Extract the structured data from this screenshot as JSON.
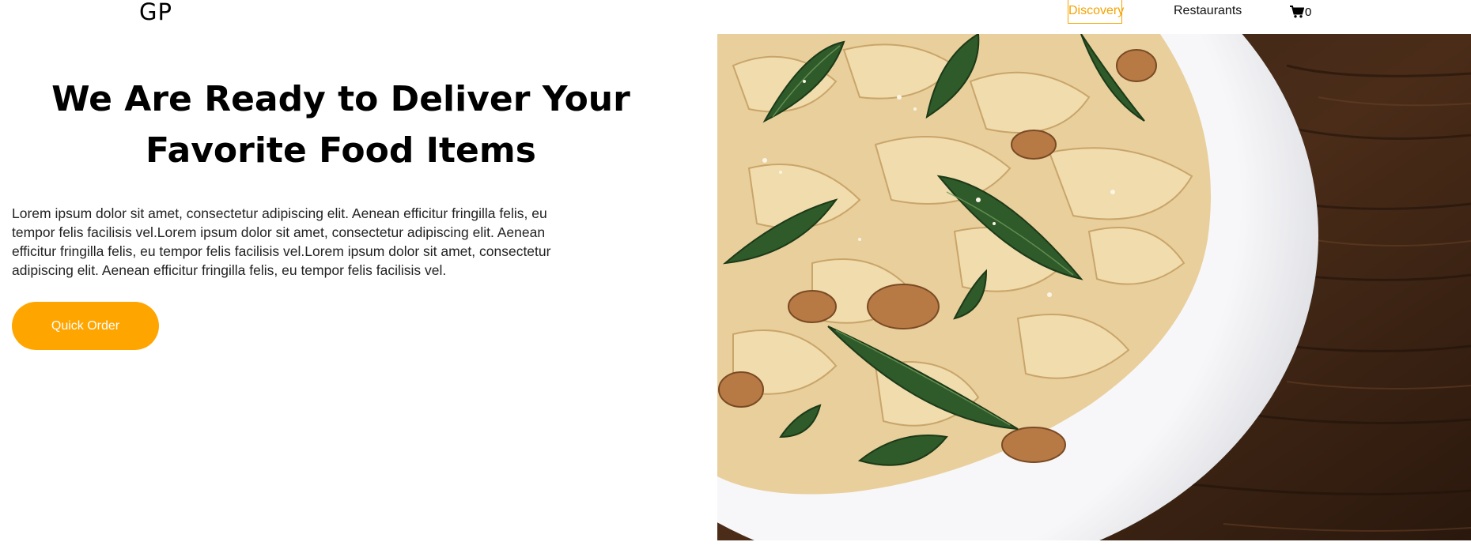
{
  "brand": {
    "logo_text": "GP"
  },
  "nav": {
    "items": [
      {
        "label": "Discovery",
        "active": true
      },
      {
        "label": "Restaurants",
        "active": false
      }
    ],
    "cart": {
      "icon": "shopping-cart-icon",
      "count": "0"
    }
  },
  "hero": {
    "title": "We Are Ready to Deliver Your Favorite Food Items",
    "description": "Lorem ipsum dolor sit amet, consectetur adipiscing elit. Aenean efficitur fringilla felis, eu tempor felis facilisis vel.Lorem ipsum dolor sit amet, consectetur adipiscing elit. Aenean efficitur fringilla felis, eu tempor felis facilisis vel.Lorem ipsum dolor sit amet, consectetur adipiscing elit. Aenean efficitur fringilla felis, eu tempor felis facilisis vel.",
    "cta_label": "Quick Order",
    "image": "pasta-dish-photo"
  },
  "colors": {
    "accent": "#ffa500",
    "nav_active": "#f5a300",
    "text": "#000000",
    "background": "#ffffff"
  }
}
